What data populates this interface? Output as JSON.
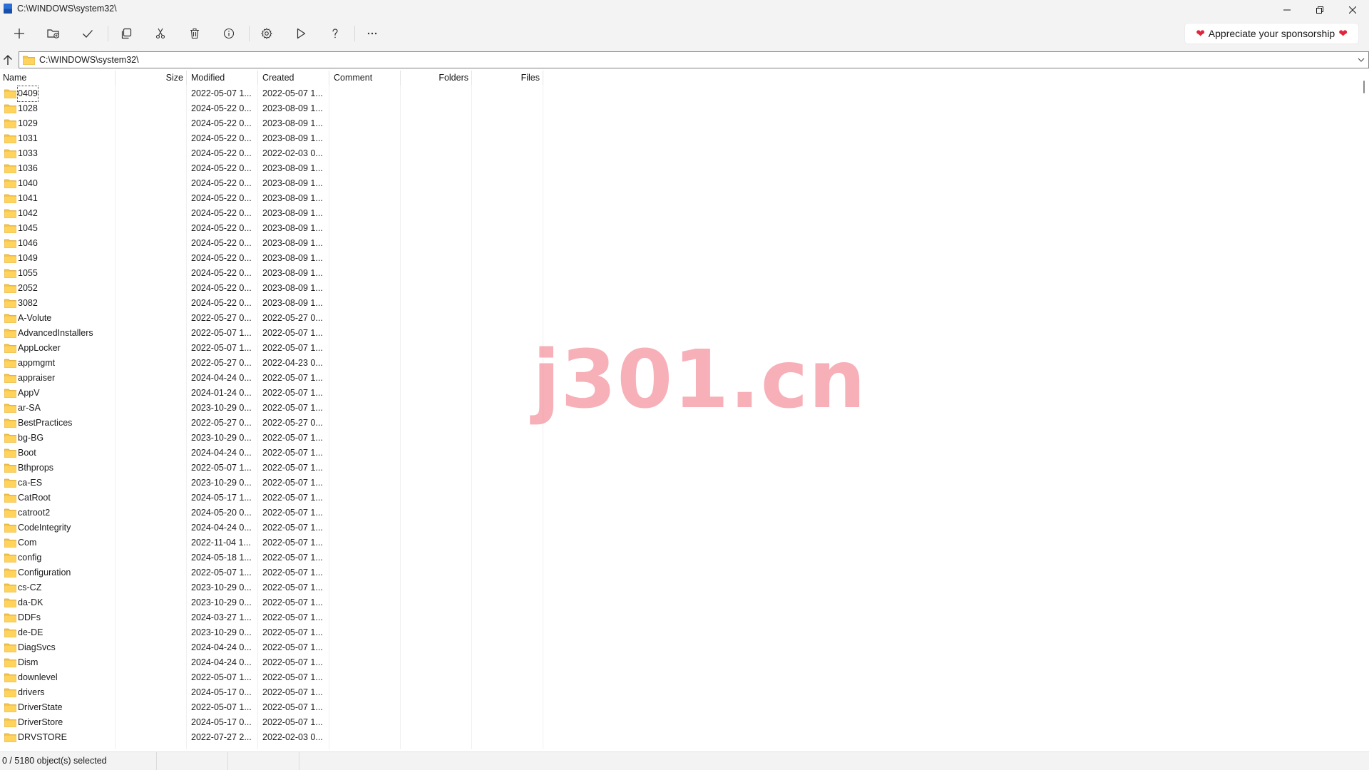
{
  "window": {
    "title": "C:\\WINDOWS\\system32\\"
  },
  "toolbar": {
    "buttons": [
      {
        "icon": "plus-icon"
      },
      {
        "icon": "new-folder-icon"
      },
      {
        "icon": "checkmark-icon"
      },
      {
        "icon": "copy-icon"
      },
      {
        "icon": "cut-icon"
      },
      {
        "icon": "delete-icon"
      },
      {
        "icon": "info-icon"
      },
      {
        "icon": "gear-icon"
      },
      {
        "icon": "play-icon"
      },
      {
        "icon": "help-icon"
      },
      {
        "icon": "more-icon"
      }
    ],
    "sponsor_label": "Appreciate your sponsorship",
    "heart_color": "#e0263a"
  },
  "address": {
    "path": "C:\\WINDOWS\\system32\\"
  },
  "columns": {
    "name": "Name",
    "size": "Size",
    "modified": "Modified",
    "created": "Created",
    "comment": "Comment",
    "folders": "Folders",
    "files": "Files"
  },
  "rows": [
    {
      "name": "0409",
      "modified": "2022-05-07 1...",
      "created": "2022-05-07 1..."
    },
    {
      "name": "1028",
      "modified": "2024-05-22 0...",
      "created": "2023-08-09 1..."
    },
    {
      "name": "1029",
      "modified": "2024-05-22 0...",
      "created": "2023-08-09 1..."
    },
    {
      "name": "1031",
      "modified": "2024-05-22 0...",
      "created": "2023-08-09 1..."
    },
    {
      "name": "1033",
      "modified": "2024-05-22 0...",
      "created": "2022-02-03 0..."
    },
    {
      "name": "1036",
      "modified": "2024-05-22 0...",
      "created": "2023-08-09 1..."
    },
    {
      "name": "1040",
      "modified": "2024-05-22 0...",
      "created": "2023-08-09 1..."
    },
    {
      "name": "1041",
      "modified": "2024-05-22 0...",
      "created": "2023-08-09 1..."
    },
    {
      "name": "1042",
      "modified": "2024-05-22 0...",
      "created": "2023-08-09 1..."
    },
    {
      "name": "1045",
      "modified": "2024-05-22 0...",
      "created": "2023-08-09 1..."
    },
    {
      "name": "1046",
      "modified": "2024-05-22 0...",
      "created": "2023-08-09 1..."
    },
    {
      "name": "1049",
      "modified": "2024-05-22 0...",
      "created": "2023-08-09 1..."
    },
    {
      "name": "1055",
      "modified": "2024-05-22 0...",
      "created": "2023-08-09 1..."
    },
    {
      "name": "2052",
      "modified": "2024-05-22 0...",
      "created": "2023-08-09 1..."
    },
    {
      "name": "3082",
      "modified": "2024-05-22 0...",
      "created": "2023-08-09 1..."
    },
    {
      "name": "A-Volute",
      "modified": "2022-05-27 0...",
      "created": "2022-05-27 0..."
    },
    {
      "name": "AdvancedInstallers",
      "modified": "2022-05-07 1...",
      "created": "2022-05-07 1..."
    },
    {
      "name": "AppLocker",
      "modified": "2022-05-07 1...",
      "created": "2022-05-07 1..."
    },
    {
      "name": "appmgmt",
      "modified": "2022-05-27 0...",
      "created": "2022-04-23 0..."
    },
    {
      "name": "appraiser",
      "modified": "2024-04-24 0...",
      "created": "2022-05-07 1..."
    },
    {
      "name": "AppV",
      "modified": "2024-01-24 0...",
      "created": "2022-05-07 1..."
    },
    {
      "name": "ar-SA",
      "modified": "2023-10-29 0...",
      "created": "2022-05-07 1..."
    },
    {
      "name": "BestPractices",
      "modified": "2022-05-27 0...",
      "created": "2022-05-27 0..."
    },
    {
      "name": "bg-BG",
      "modified": "2023-10-29 0...",
      "created": "2022-05-07 1..."
    },
    {
      "name": "Boot",
      "modified": "2024-04-24 0...",
      "created": "2022-05-07 1..."
    },
    {
      "name": "Bthprops",
      "modified": "2022-05-07 1...",
      "created": "2022-05-07 1..."
    },
    {
      "name": "ca-ES",
      "modified": "2023-10-29 0...",
      "created": "2022-05-07 1..."
    },
    {
      "name": "CatRoot",
      "modified": "2024-05-17 1...",
      "created": "2022-05-07 1..."
    },
    {
      "name": "catroot2",
      "modified": "2024-05-20 0...",
      "created": "2022-05-07 1..."
    },
    {
      "name": "CodeIntegrity",
      "modified": "2024-04-24 0...",
      "created": "2022-05-07 1..."
    },
    {
      "name": "Com",
      "modified": "2022-11-04 1...",
      "created": "2022-05-07 1..."
    },
    {
      "name": "config",
      "modified": "2024-05-18 1...",
      "created": "2022-05-07 1..."
    },
    {
      "name": "Configuration",
      "modified": "2022-05-07 1...",
      "created": "2022-05-07 1..."
    },
    {
      "name": "cs-CZ",
      "modified": "2023-10-29 0...",
      "created": "2022-05-07 1..."
    },
    {
      "name": "da-DK",
      "modified": "2023-10-29 0...",
      "created": "2022-05-07 1..."
    },
    {
      "name": "DDFs",
      "modified": "2024-03-27 1...",
      "created": "2022-05-07 1..."
    },
    {
      "name": "de-DE",
      "modified": "2023-10-29 0...",
      "created": "2022-05-07 1..."
    },
    {
      "name": "DiagSvcs",
      "modified": "2024-04-24 0...",
      "created": "2022-05-07 1..."
    },
    {
      "name": "Dism",
      "modified": "2024-04-24 0...",
      "created": "2022-05-07 1..."
    },
    {
      "name": "downlevel",
      "modified": "2022-05-07 1...",
      "created": "2022-05-07 1..."
    },
    {
      "name": "drivers",
      "modified": "2024-05-17 0...",
      "created": "2022-05-07 1..."
    },
    {
      "name": "DriverState",
      "modified": "2022-05-07 1...",
      "created": "2022-05-07 1..."
    },
    {
      "name": "DriverStore",
      "modified": "2024-05-17 0...",
      "created": "2022-05-07 1..."
    },
    {
      "name": "DRVSTORE",
      "modified": "2022-07-27 2...",
      "created": "2022-02-03 0..."
    }
  ],
  "watermark": "j301.cn",
  "status": {
    "selection": "0 / 5180 object(s) selected"
  }
}
